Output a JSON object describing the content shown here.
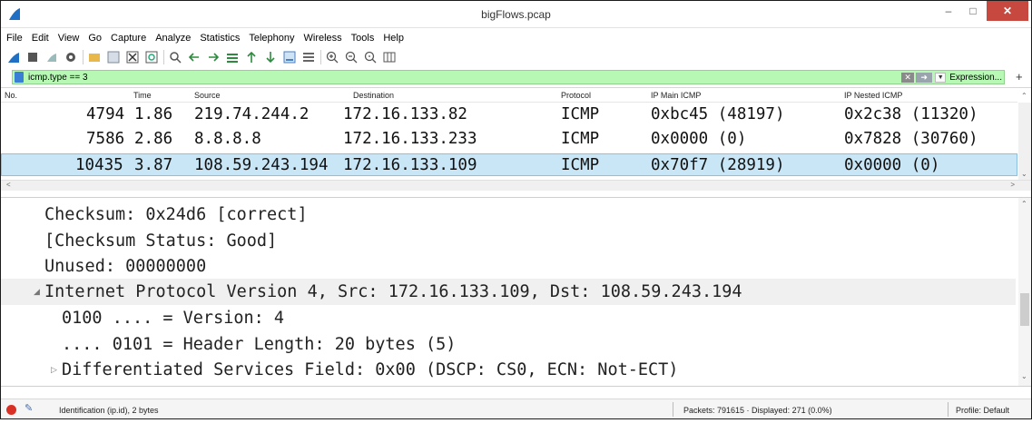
{
  "window": {
    "title": "bigFlows.pcap"
  },
  "menu": [
    "File",
    "Edit",
    "View",
    "Go",
    "Capture",
    "Analyze",
    "Statistics",
    "Telephony",
    "Wireless",
    "Tools",
    "Help"
  ],
  "filter": {
    "text": "icmp.type == 3",
    "expression_label": "Expression...",
    "plus_label": "+"
  },
  "packet_list": {
    "columns": [
      "No.",
      "Time",
      "Source",
      "Destination",
      "Protocol",
      "IP Main ICMP",
      "IP Nested ICMP"
    ],
    "rows": [
      {
        "no": "4794",
        "time": "1.86",
        "source": "219.74.244.2",
        "destination": "172.16.133.82",
        "protocol": "ICMP",
        "main_icmp": "0xbc45 (48197)",
        "nested_icmp": "0x2c38 (11320)",
        "selected": false
      },
      {
        "no": "7586",
        "time": "2.86",
        "source": "8.8.8.8",
        "destination": "172.16.133.233",
        "protocol": "ICMP",
        "main_icmp": "0x0000 (0)",
        "nested_icmp": "0x7828 (30760)",
        "selected": false
      },
      {
        "no": "10435",
        "time": "3.87",
        "source": "108.59.243.194",
        "destination": "172.16.133.109",
        "protocol": "ICMP",
        "main_icmp": "0x70f7 (28919)",
        "nested_icmp": "0x0000 (0)",
        "selected": true
      }
    ]
  },
  "details": {
    "lines": [
      "Checksum: 0x24d6 [correct]",
      "[Checksum Status: Good]",
      "Unused: 00000000",
      "Internet Protocol Version 4, Src: 172.16.133.109, Dst: 108.59.243.194",
      "0100 .... = Version: 4",
      ".... 0101 = Header Length: 20 bytes (5)",
      "Differentiated Services Field: 0x00 (DSCP: CS0, ECN: Not-ECT)"
    ]
  },
  "status": {
    "field_info": "Identification (ip.id), 2 bytes",
    "packets": "Packets: 791615 · Displayed: 271 (0.0%)",
    "profile": "Profile: Default"
  },
  "colors": {
    "filter_bg": "#b7f8b5",
    "selected_row": "#c9e6f6",
    "close_btn": "#c7483f"
  }
}
